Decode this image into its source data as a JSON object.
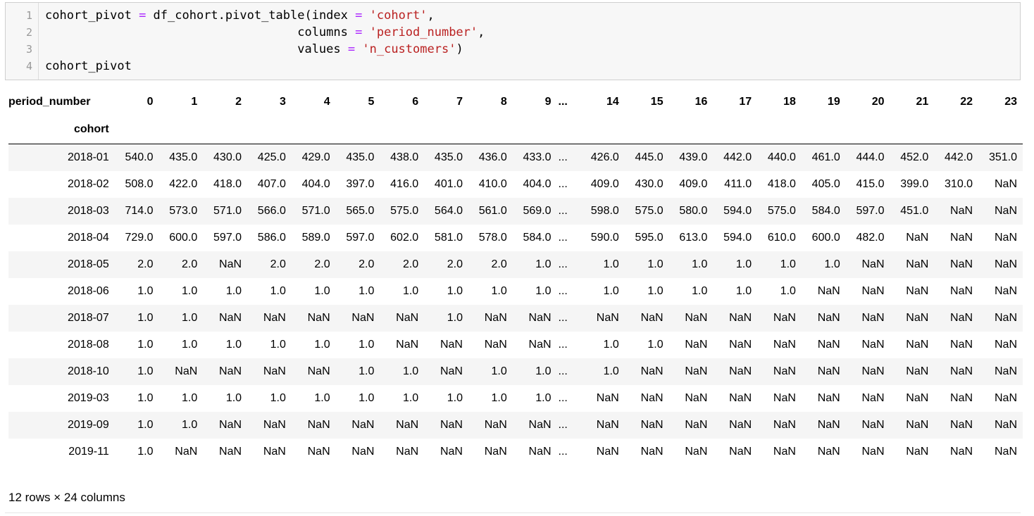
{
  "code_cell": {
    "lines": [
      {
        "no": "1",
        "tokens": [
          {
            "t": "cohort_pivot ",
            "c": ""
          },
          {
            "t": "=",
            "c": "op"
          },
          {
            "t": " df_cohort.pivot_table(index ",
            "c": ""
          },
          {
            "t": "=",
            "c": "op"
          },
          {
            "t": " ",
            "c": ""
          },
          {
            "t": "'cohort'",
            "c": "str"
          },
          {
            "t": ",",
            "c": ""
          }
        ]
      },
      {
        "no": "2",
        "tokens": [
          {
            "t": "                                   columns ",
            "c": ""
          },
          {
            "t": "=",
            "c": "op"
          },
          {
            "t": " ",
            "c": ""
          },
          {
            "t": "'period_number'",
            "c": "str"
          },
          {
            "t": ",",
            "c": ""
          }
        ]
      },
      {
        "no": "3",
        "tokens": [
          {
            "t": "                                   values ",
            "c": ""
          },
          {
            "t": "=",
            "c": "op"
          },
          {
            "t": " ",
            "c": ""
          },
          {
            "t": "'n_customers'",
            "c": "str"
          },
          {
            "t": ")",
            "c": ""
          }
        ]
      },
      {
        "no": "4",
        "tokens": [
          {
            "t": "cohort_pivot",
            "c": ""
          }
        ]
      }
    ]
  },
  "table": {
    "columns_name": "period_number",
    "index_name": "cohort",
    "columns": [
      "0",
      "1",
      "2",
      "3",
      "4",
      "5",
      "6",
      "7",
      "8",
      "9",
      "...",
      "14",
      "15",
      "16",
      "17",
      "18",
      "19",
      "20",
      "21",
      "22",
      "23"
    ],
    "rows": [
      {
        "index": "2018-01",
        "values": [
          "540.0",
          "435.0",
          "430.0",
          "425.0",
          "429.0",
          "435.0",
          "438.0",
          "435.0",
          "436.0",
          "433.0",
          "...",
          "426.0",
          "445.0",
          "439.0",
          "442.0",
          "440.0",
          "461.0",
          "444.0",
          "452.0",
          "442.0",
          "351.0"
        ]
      },
      {
        "index": "2018-02",
        "values": [
          "508.0",
          "422.0",
          "418.0",
          "407.0",
          "404.0",
          "397.0",
          "416.0",
          "401.0",
          "410.0",
          "404.0",
          "...",
          "409.0",
          "430.0",
          "409.0",
          "411.0",
          "418.0",
          "405.0",
          "415.0",
          "399.0",
          "310.0",
          "NaN"
        ]
      },
      {
        "index": "2018-03",
        "values": [
          "714.0",
          "573.0",
          "571.0",
          "566.0",
          "571.0",
          "565.0",
          "575.0",
          "564.0",
          "561.0",
          "569.0",
          "...",
          "598.0",
          "575.0",
          "580.0",
          "594.0",
          "575.0",
          "584.0",
          "597.0",
          "451.0",
          "NaN",
          "NaN"
        ]
      },
      {
        "index": "2018-04",
        "values": [
          "729.0",
          "600.0",
          "597.0",
          "586.0",
          "589.0",
          "597.0",
          "602.0",
          "581.0",
          "578.0",
          "584.0",
          "...",
          "590.0",
          "595.0",
          "613.0",
          "594.0",
          "610.0",
          "600.0",
          "482.0",
          "NaN",
          "NaN",
          "NaN"
        ]
      },
      {
        "index": "2018-05",
        "values": [
          "2.0",
          "2.0",
          "NaN",
          "2.0",
          "2.0",
          "2.0",
          "2.0",
          "2.0",
          "2.0",
          "1.0",
          "...",
          "1.0",
          "1.0",
          "1.0",
          "1.0",
          "1.0",
          "1.0",
          "NaN",
          "NaN",
          "NaN",
          "NaN"
        ]
      },
      {
        "index": "2018-06",
        "values": [
          "1.0",
          "1.0",
          "1.0",
          "1.0",
          "1.0",
          "1.0",
          "1.0",
          "1.0",
          "1.0",
          "1.0",
          "...",
          "1.0",
          "1.0",
          "1.0",
          "1.0",
          "1.0",
          "NaN",
          "NaN",
          "NaN",
          "NaN",
          "NaN"
        ]
      },
      {
        "index": "2018-07",
        "values": [
          "1.0",
          "1.0",
          "NaN",
          "NaN",
          "NaN",
          "NaN",
          "NaN",
          "1.0",
          "NaN",
          "NaN",
          "...",
          "NaN",
          "NaN",
          "NaN",
          "NaN",
          "NaN",
          "NaN",
          "NaN",
          "NaN",
          "NaN",
          "NaN"
        ]
      },
      {
        "index": "2018-08",
        "values": [
          "1.0",
          "1.0",
          "1.0",
          "1.0",
          "1.0",
          "1.0",
          "NaN",
          "NaN",
          "NaN",
          "NaN",
          "...",
          "1.0",
          "1.0",
          "NaN",
          "NaN",
          "NaN",
          "NaN",
          "NaN",
          "NaN",
          "NaN",
          "NaN"
        ]
      },
      {
        "index": "2018-10",
        "values": [
          "1.0",
          "NaN",
          "NaN",
          "NaN",
          "NaN",
          "1.0",
          "1.0",
          "NaN",
          "1.0",
          "1.0",
          "...",
          "1.0",
          "NaN",
          "NaN",
          "NaN",
          "NaN",
          "NaN",
          "NaN",
          "NaN",
          "NaN",
          "NaN"
        ]
      },
      {
        "index": "2019-03",
        "values": [
          "1.0",
          "1.0",
          "1.0",
          "1.0",
          "1.0",
          "1.0",
          "1.0",
          "1.0",
          "1.0",
          "1.0",
          "...",
          "NaN",
          "NaN",
          "NaN",
          "NaN",
          "NaN",
          "NaN",
          "NaN",
          "NaN",
          "NaN",
          "NaN"
        ]
      },
      {
        "index": "2019-09",
        "values": [
          "1.0",
          "1.0",
          "NaN",
          "NaN",
          "NaN",
          "NaN",
          "NaN",
          "NaN",
          "NaN",
          "NaN",
          "...",
          "NaN",
          "NaN",
          "NaN",
          "NaN",
          "NaN",
          "NaN",
          "NaN",
          "NaN",
          "NaN",
          "NaN"
        ]
      },
      {
        "index": "2019-11",
        "values": [
          "1.0",
          "NaN",
          "NaN",
          "NaN",
          "NaN",
          "NaN",
          "NaN",
          "NaN",
          "NaN",
          "NaN",
          "...",
          "NaN",
          "NaN",
          "NaN",
          "NaN",
          "NaN",
          "NaN",
          "NaN",
          "NaN",
          "NaN",
          "NaN"
        ]
      }
    ]
  },
  "shape_caption": "12 rows × 24 columns",
  "colors": {
    "operator": "#aa22ff",
    "string": "#ba2121",
    "line_number": "#999999",
    "cell_background": "#f7f7f7",
    "stripe": "#f5f5f5"
  }
}
